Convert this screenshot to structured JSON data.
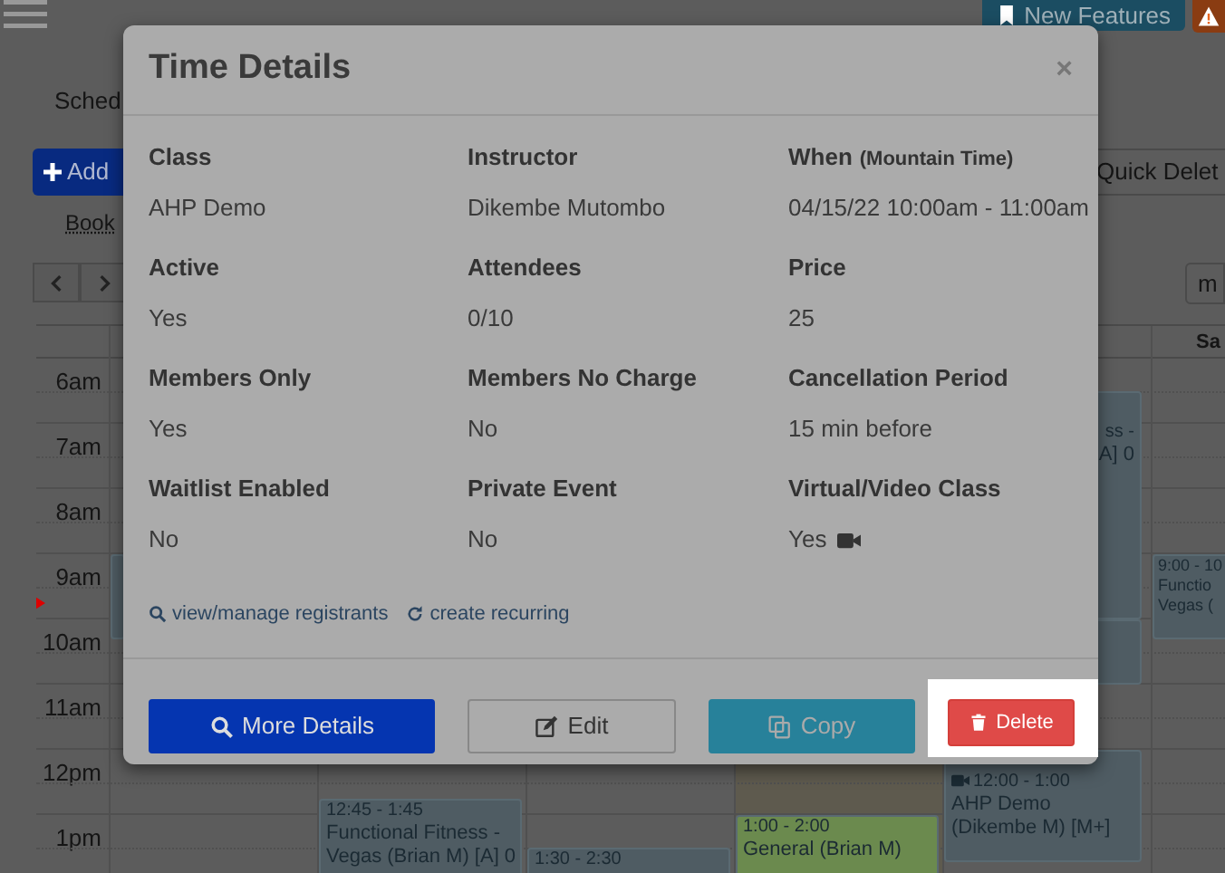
{
  "top_bar": {
    "new_features": "New Features"
  },
  "page": {
    "tab": "Sched",
    "add_button": "Add",
    "book_link": "Book",
    "quick_delete": "Quick Delet",
    "view_button": "m"
  },
  "calendar": {
    "day_header": "Sa",
    "hours": [
      "6am",
      "7am",
      "8am",
      "9am",
      "10am",
      "11am",
      "12pm",
      "1pm"
    ],
    "events": [
      {
        "lines": [
          "ss -",
          "A] 0"
        ],
        "virtual": false,
        "color": "#4f5c63"
      },
      {
        "lines": [
          "9:00 - 10",
          "Functio",
          "Vegas ("
        ],
        "virtual": false,
        "color": "#4f5c63"
      },
      {
        "lines": [
          "12:00 - 1:00",
          "AHP Demo",
          "(Dikembe M) [M+]"
        ],
        "virtual": true,
        "color": "#4f5c63"
      },
      {
        "lines": [
          "12:45 - 1:45",
          "Functional Fitness -",
          "Vegas (Brian M) [A] 0"
        ],
        "virtual": false,
        "color": "#4f5c63"
      },
      {
        "lines": [
          "1:30 - 2:30"
        ],
        "virtual": false,
        "color": "#4f5c63"
      },
      {
        "lines": [
          "1:00 - 2:00",
          "General (Brian M)"
        ],
        "virtual": false,
        "color": "#6b8a4e"
      }
    ]
  },
  "modal": {
    "title": "Time Details",
    "close": "×",
    "fields": [
      {
        "label": "Class",
        "value": "AHP Demo"
      },
      {
        "label": "Instructor",
        "value": "Dikembe Mutombo"
      },
      {
        "label": "When",
        "note": "(Mountain Time)",
        "value": "04/15/22 10:00am - 11:00am"
      },
      {
        "label": "Active",
        "value": "Yes"
      },
      {
        "label": "Attendees",
        "value": "0/10"
      },
      {
        "label": "Price",
        "value": "25"
      },
      {
        "label": "Members Only",
        "value": "Yes"
      },
      {
        "label": "Members No Charge",
        "value": "No"
      },
      {
        "label": "Cancellation Period",
        "value": "15 min before"
      },
      {
        "label": "Waitlist Enabled",
        "value": "No"
      },
      {
        "label": "Private Event",
        "value": "No"
      },
      {
        "label": "Virtual/Video Class",
        "value": "Yes",
        "video": true
      }
    ],
    "links": [
      {
        "kind": "search",
        "label": "view/manage registrants"
      },
      {
        "kind": "recurring",
        "label": "create recurring"
      }
    ],
    "buttons": [
      {
        "kind": "details",
        "label": "More Details",
        "spotlight": false
      },
      {
        "kind": "edit",
        "label": "Edit",
        "spotlight": false
      },
      {
        "kind": "copy",
        "label": "Copy",
        "spotlight": false
      },
      {
        "kind": "delete",
        "label": "Delete",
        "spotlight": true
      }
    ]
  }
}
